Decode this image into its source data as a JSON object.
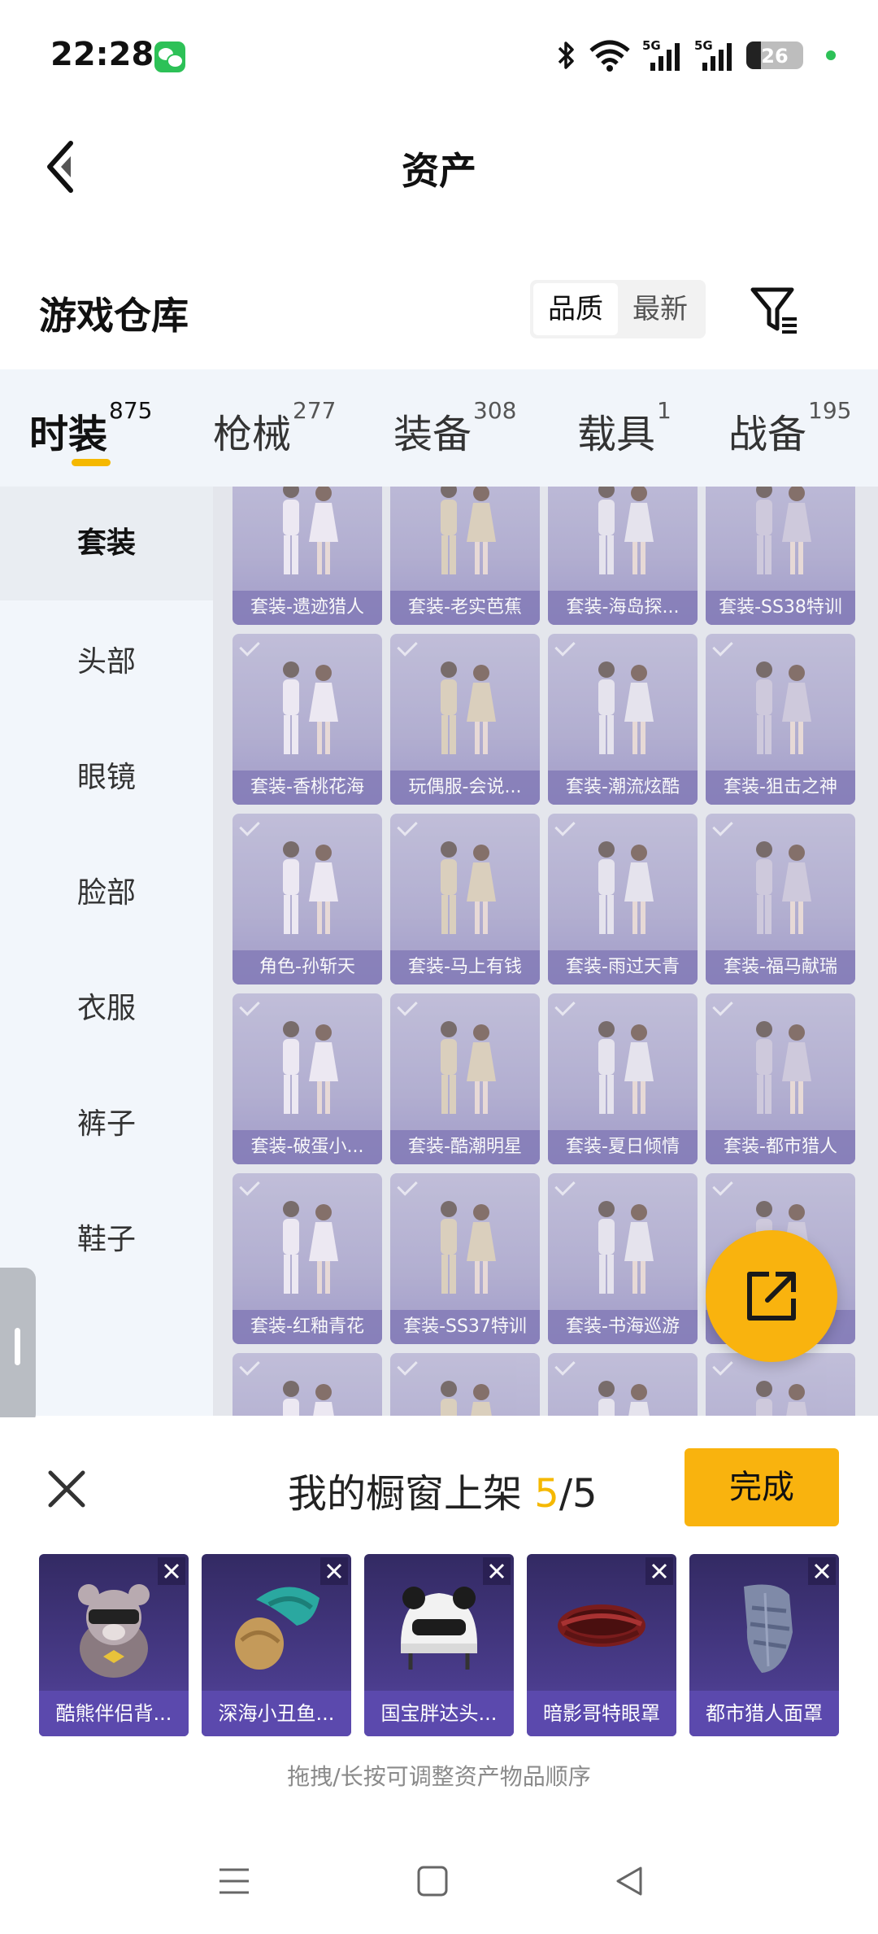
{
  "status_bar": {
    "time": "22:28",
    "battery_level": "26",
    "icons": [
      "wechat-icon",
      "bluetooth-icon",
      "wifi-icon",
      "signal-5g-icon",
      "signal-5g-icon",
      "battery-icon"
    ]
  },
  "header": {
    "title": "资产",
    "back_icon": "chevron-left-icon"
  },
  "section": {
    "title": "游戏仓库",
    "sort_options": [
      "品质",
      "最新"
    ],
    "sort_selected": "品质",
    "filter_icon": "filter-icon"
  },
  "tabs": [
    {
      "label": "时装",
      "count": "875",
      "active": true
    },
    {
      "label": "枪械",
      "count": "277",
      "active": false
    },
    {
      "label": "装备",
      "count": "308",
      "active": false
    },
    {
      "label": "载具",
      "count": "1",
      "active": false
    },
    {
      "label": "战备",
      "count": "195",
      "active": false
    }
  ],
  "sidebar": {
    "items": [
      {
        "label": "套装",
        "active": true
      },
      {
        "label": "头部",
        "active": false
      },
      {
        "label": "眼镜",
        "active": false
      },
      {
        "label": "脸部",
        "active": false
      },
      {
        "label": "衣服",
        "active": false
      },
      {
        "label": "裤子",
        "active": false
      },
      {
        "label": "鞋子",
        "active": false
      }
    ]
  },
  "grid": {
    "items": [
      "套装-遗迹猎人",
      "套装-老实芭蕉",
      "套装-海岛探...",
      "套装-SS38特训",
      "套装-香桃花海",
      "玩偶服-会说...",
      "套装-潮流炫酷",
      "套装-狙击之神",
      "角色-孙斩天",
      "套装-马上有钱",
      "套装-雨过天青",
      "套装-福马献瑞",
      "套装-破蛋小...",
      "套装-酷潮明星",
      "套装-夏日倾情",
      "套装-都市猎人",
      "套装-红釉青花",
      "套装-SS37特训",
      "套装-书海巡游",
      "星",
      "",
      "",
      "",
      ""
    ]
  },
  "fab": {
    "icon": "share-out-icon"
  },
  "showcase": {
    "title_prefix": "我的橱窗上架 ",
    "current": "5",
    "separator": "/",
    "total": "5",
    "done_label": "完成",
    "close_icon": "close-icon",
    "items": [
      "酷熊伴侣背...",
      "深海小丑鱼...",
      "国宝胖达头...",
      "暗影哥特眼罩",
      "都市猎人面罩"
    ],
    "hint": "拖拽/长按可调整资产物品顺序"
  },
  "navbar": {
    "icons": [
      "menu-icon",
      "home-square-icon",
      "back-triangle-icon"
    ]
  }
}
